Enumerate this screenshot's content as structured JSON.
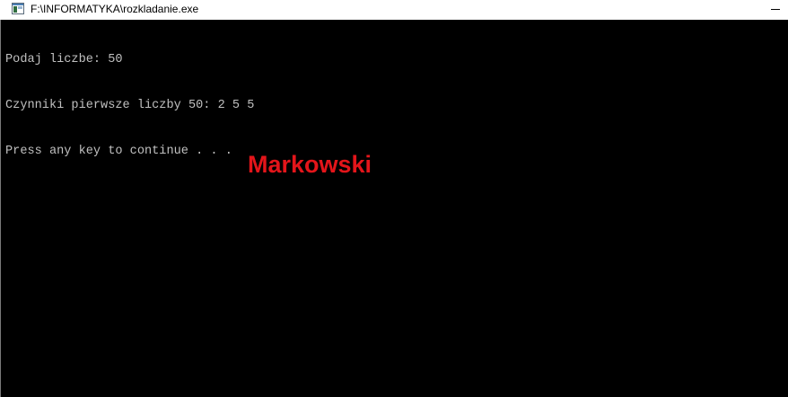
{
  "window": {
    "title": "F:\\INFORMATYKA\\rozkladanie.exe",
    "icon": "console-app-icon"
  },
  "console": {
    "lines": [
      "Podaj liczbe: 50",
      "Czynniki pierwsze liczby 50: 2 5 5",
      "Press any key to continue . . ."
    ],
    "text_color": "#c0c0c0",
    "background_color": "#000000"
  },
  "watermark": {
    "text": "Markowski",
    "color": "#e3151a"
  }
}
